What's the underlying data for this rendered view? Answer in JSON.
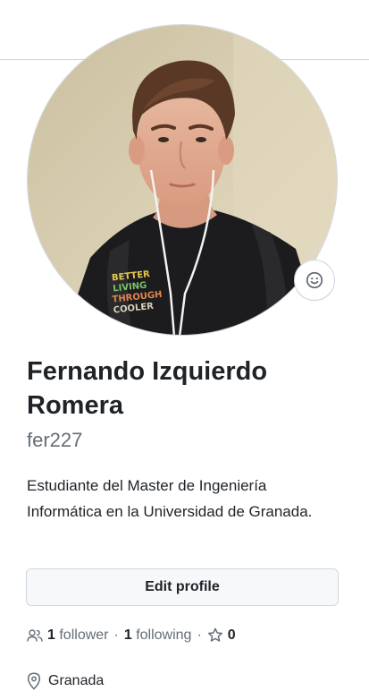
{
  "profile": {
    "full_name": "Fernando Izquierdo Romera",
    "login": "fer227",
    "bio": "Estudiante del Master de Ingeniería Informática en la Universidad de Granada.",
    "edit_button_label": "Edit profile",
    "followers_count": "1",
    "followers_label": "follower",
    "following_count": "1",
    "following_label": "following",
    "stars_count": "0",
    "location": "Granada",
    "separator": "·"
  },
  "avatar": {
    "shirt_text": [
      "BETTER",
      "LIVING",
      "THROUGH",
      "COOLER"
    ]
  },
  "icons": {
    "status": "smiley-icon",
    "followers": "people-icon",
    "stars": "star-icon",
    "location": "location-pin-icon"
  }
}
